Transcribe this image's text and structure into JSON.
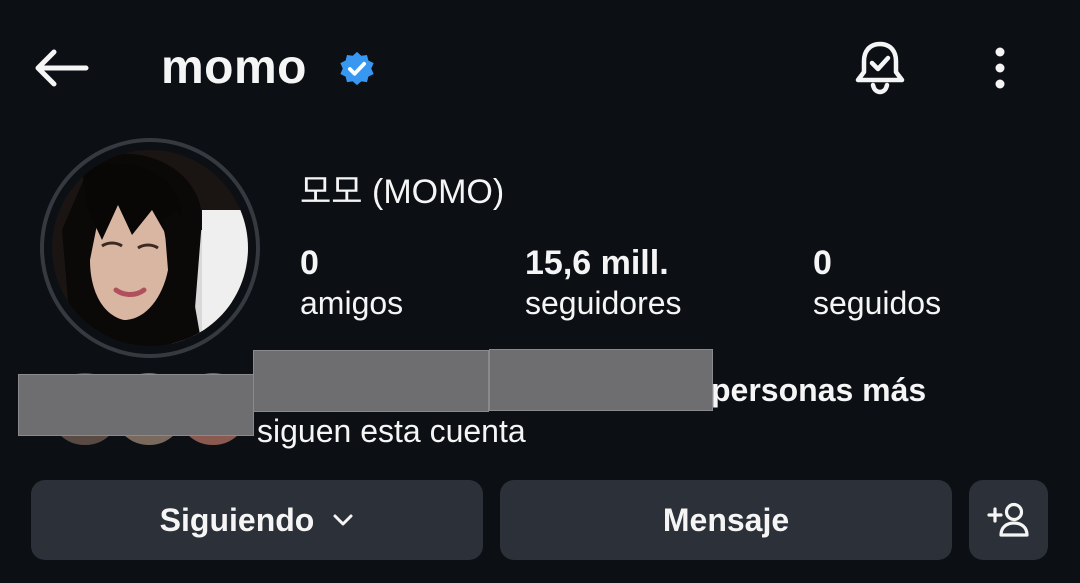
{
  "header": {
    "title": "momo",
    "verified_color": "#3897f0",
    "icons": [
      "back-arrow-icon",
      "verified-badge-icon",
      "notification-bell-icon",
      "more-options-icon"
    ]
  },
  "profile": {
    "full_name": "모모 (MOMO)",
    "stats": [
      {
        "value": "0",
        "label": "amigos"
      },
      {
        "value": "15,6 mill.",
        "label": "seguidores"
      },
      {
        "value": "0",
        "label": "seguidos"
      }
    ]
  },
  "mutual": {
    "line1": "personas más",
    "line2": "siguen esta cuenta"
  },
  "actions": {
    "following_label": "Siguiendo",
    "message_label": "Mensaje"
  },
  "colors": {
    "background": "#0c1014",
    "button_bg": "#2c3038",
    "text": "#f5f5f5"
  }
}
